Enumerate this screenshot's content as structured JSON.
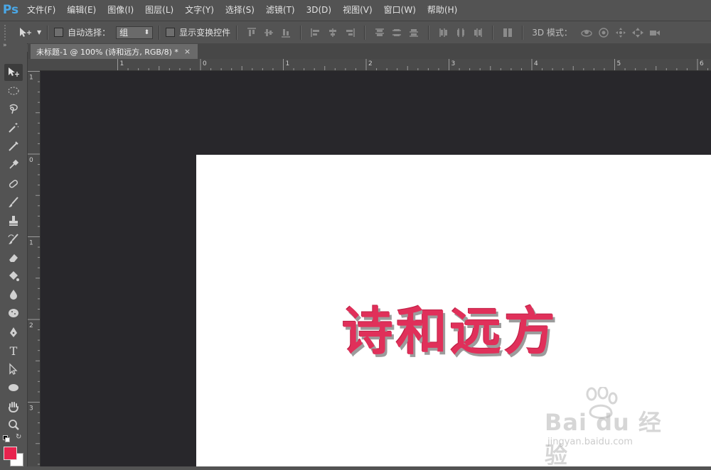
{
  "app": {
    "logo": "Ps"
  },
  "menu": [
    "文件(F)",
    "编辑(E)",
    "图像(I)",
    "图层(L)",
    "文字(Y)",
    "选择(S)",
    "滤镜(T)",
    "3D(D)",
    "视图(V)",
    "窗口(W)",
    "帮助(H)"
  ],
  "options": {
    "auto_select_label": "自动选择：",
    "auto_select_value": "组",
    "auto_select_checked": false,
    "show_transform_label": "显示变换控件",
    "show_transform_checked": false,
    "mode_3d_label": "3D 模式："
  },
  "document_tab": {
    "title": "未标题-1 @ 100% (诗和远方, RGB/8) *",
    "close": "×"
  },
  "ruler": {
    "horizontal_labels": [
      "1",
      "0",
      "1",
      "2",
      "3",
      "4",
      "5",
      "6"
    ],
    "vertical_labels": [
      "1",
      "0",
      "1",
      "2",
      "3"
    ]
  },
  "canvas": {
    "text": "诗和远方",
    "text_color": "#e0305a",
    "background": "#ffffff"
  },
  "colors": {
    "foreground": "#e8234e",
    "background": "#ffffff",
    "ui_panel": "#535353",
    "pasteboard": "#28272b"
  },
  "watermark": {
    "brand": "Bai du 经验",
    "url": "jingyan.baidu.com"
  }
}
